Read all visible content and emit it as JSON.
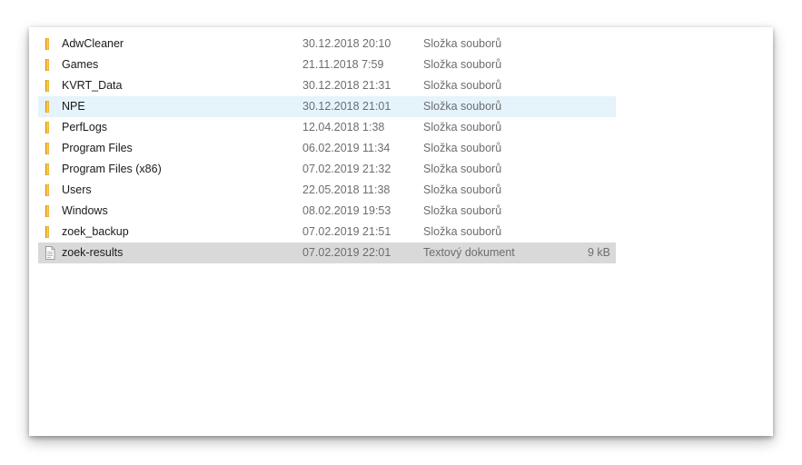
{
  "files": [
    {
      "name": "AdwCleaner",
      "date": "30.12.2018 20:10",
      "type": "Složka souborů",
      "size": "",
      "icon": "folder-icon",
      "state": "normal"
    },
    {
      "name": "Games",
      "date": "21.11.2018 7:59",
      "type": "Složka souborů",
      "size": "",
      "icon": "folder-icon",
      "state": "normal"
    },
    {
      "name": "KVRT_Data",
      "date": "30.12.2018 21:31",
      "type": "Složka souborů",
      "size": "",
      "icon": "folder-icon",
      "state": "normal"
    },
    {
      "name": "NPE",
      "date": "30.12.2018 21:01",
      "type": "Složka souborů",
      "size": "",
      "icon": "folder-icon",
      "state": "hover"
    },
    {
      "name": "PerfLogs",
      "date": "12.04.2018 1:38",
      "type": "Složka souborů",
      "size": "",
      "icon": "folder-icon",
      "state": "normal"
    },
    {
      "name": "Program Files",
      "date": "06.02.2019 11:34",
      "type": "Složka souborů",
      "size": "",
      "icon": "folder-icon",
      "state": "normal"
    },
    {
      "name": "Program Files (x86)",
      "date": "07.02.2019 21:32",
      "type": "Složka souborů",
      "size": "",
      "icon": "folder-icon",
      "state": "normal"
    },
    {
      "name": "Users",
      "date": "22.05.2018 11:38",
      "type": "Složka souborů",
      "size": "",
      "icon": "folder-icon",
      "state": "normal"
    },
    {
      "name": "Windows",
      "date": "08.02.2019 19:53",
      "type": "Složka souborů",
      "size": "",
      "icon": "folder-icon",
      "state": "normal"
    },
    {
      "name": "zoek_backup",
      "date": "07.02.2019 21:51",
      "type": "Složka souborů",
      "size": "",
      "icon": "folder-icon",
      "state": "normal"
    },
    {
      "name": "zoek-results",
      "date": "07.02.2019 22:01",
      "type": "Textový dokument",
      "size": "9 kB",
      "icon": "text-file-icon",
      "state": "selected"
    }
  ],
  "colors": {
    "hover_row": "#e5f3fb",
    "selected_row": "#d9d9d9",
    "folder": "#f8c84d",
    "meta_text": "#6d6d6d"
  }
}
